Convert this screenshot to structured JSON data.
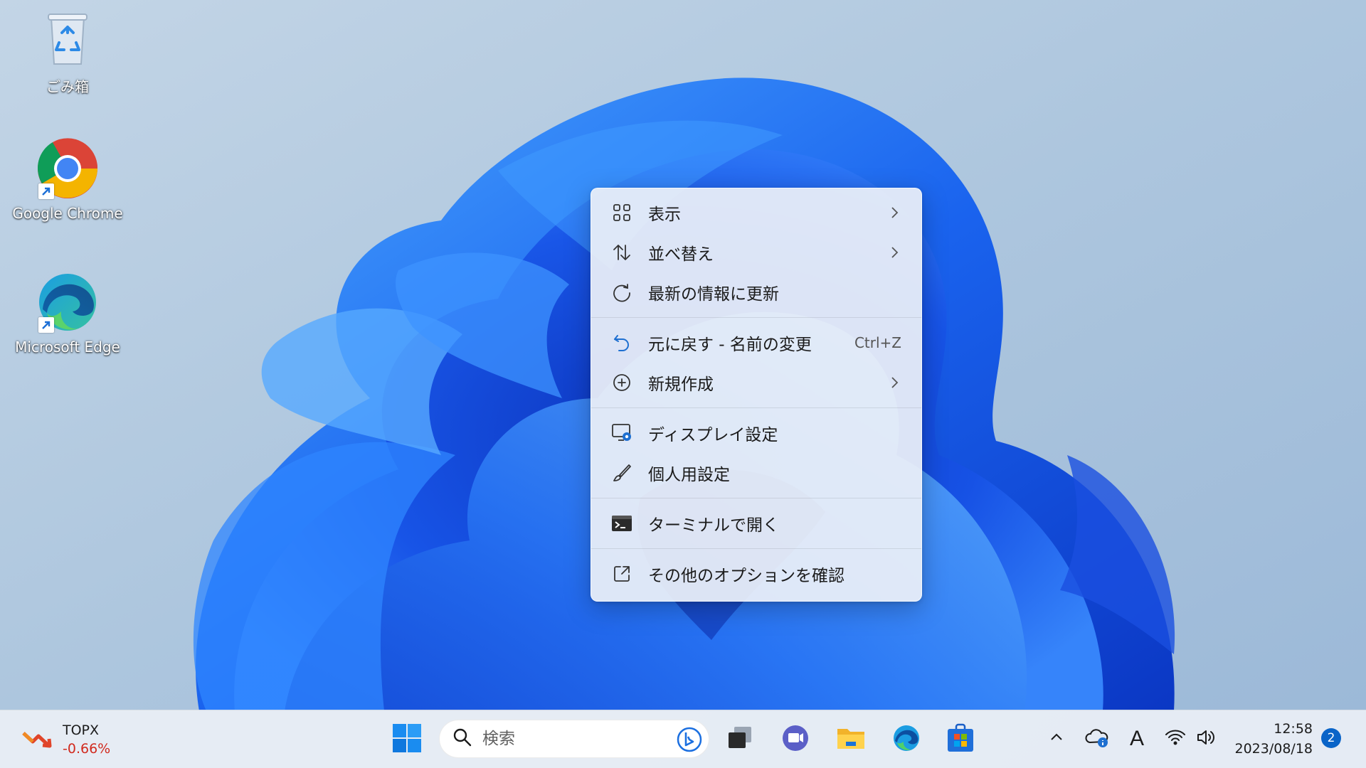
{
  "desktop": {
    "icons": [
      {
        "label": "ごみ箱",
        "icon": "recycle-bin-icon"
      },
      {
        "label": "Google Chrome",
        "icon": "chrome-icon"
      },
      {
        "label": "Microsoft Edge",
        "icon": "edge-icon"
      }
    ]
  },
  "context_menu": {
    "items": [
      {
        "label": "表示",
        "icon": "grid-view-icon",
        "submenu": true
      },
      {
        "label": "並べ替え",
        "icon": "sort-icon",
        "submenu": true
      },
      {
        "label": "最新の情報に更新",
        "icon": "refresh-icon"
      },
      {
        "label": "元に戻す - 名前の変更",
        "icon": "undo-icon",
        "shortcut": "Ctrl+Z"
      },
      {
        "label": "新規作成",
        "icon": "plus-circle-icon",
        "submenu": true
      },
      {
        "label": "ディスプレイ設定",
        "icon": "display-settings-icon"
      },
      {
        "label": "個人用設定",
        "icon": "brush-icon"
      },
      {
        "label": "ターミナルで開く",
        "icon": "terminal-icon"
      },
      {
        "label": "その他のオプションを確認",
        "icon": "more-options-icon"
      }
    ]
  },
  "taskbar": {
    "widget": {
      "name": "TOPX",
      "value": "-0.66%",
      "value_color": "#d12a1e"
    },
    "search": {
      "placeholder": "検索"
    },
    "apps": [
      "start-icon",
      "task-view-icon",
      "teams-chat-icon",
      "file-explorer-icon",
      "edge-icon",
      "store-icon"
    ],
    "tray": [
      "chevron-up-icon",
      "onedrive-icon",
      "ime-icon",
      "wifi-icon",
      "volume-icon"
    ],
    "ime_label": "A",
    "clock": {
      "time": "12:58",
      "date": "2023/08/18"
    },
    "notification_count": "2"
  },
  "colors": {
    "accent": "#0a64c8",
    "wallpaper_blue": "#1d5ff0"
  }
}
